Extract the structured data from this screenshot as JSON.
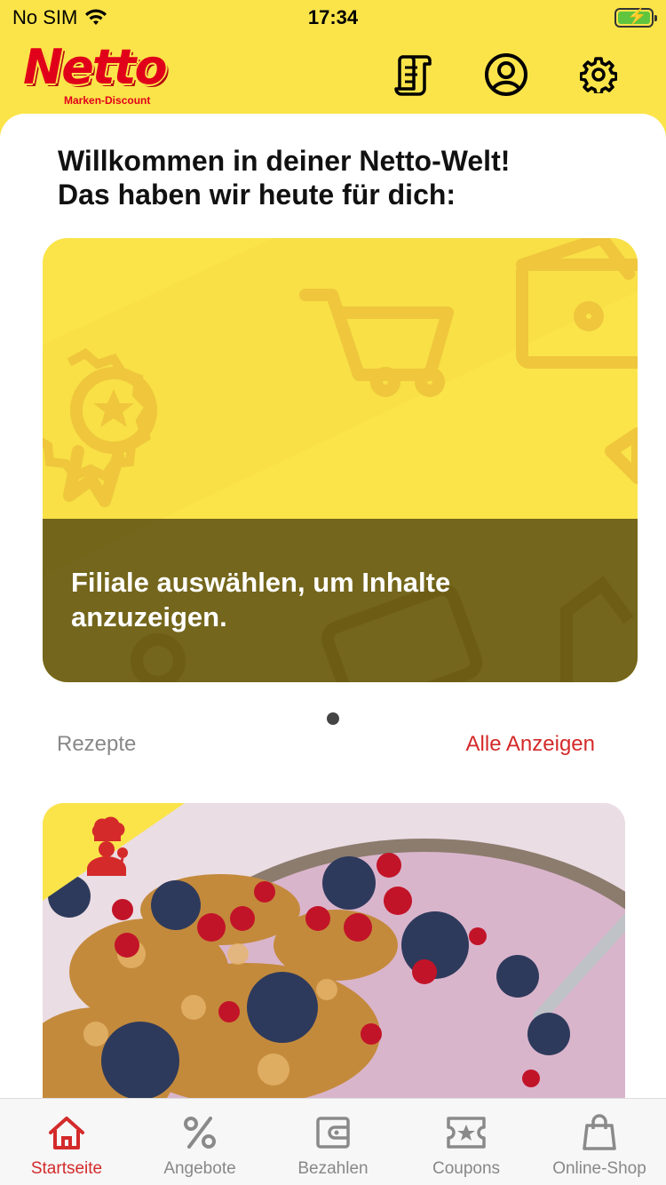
{
  "status": {
    "carrier": "No SIM",
    "time": "17:34"
  },
  "header": {
    "logo_word": "Netto",
    "logo_sub": "Marken-Discount",
    "icons": [
      "receipt-icon",
      "account-icon",
      "gear-icon"
    ]
  },
  "welcome": "Willkommen in deiner Netto-Welt!\nDas haben wir heute für dich:",
  "hero": {
    "text": "Filiale auswählen, um Inhalte anzuzeigen."
  },
  "recipes": {
    "label": "Rezepte",
    "all_label": "Alle Anzeigen"
  },
  "tabs": [
    {
      "label": "Startseite",
      "icon": "home-icon",
      "active": true
    },
    {
      "label": "Angebote",
      "icon": "percent-icon",
      "active": false
    },
    {
      "label": "Bezahlen",
      "icon": "wallet-icon",
      "active": false
    },
    {
      "label": "Coupons",
      "icon": "coupon-icon",
      "active": false
    },
    {
      "label": "Online-Shop",
      "icon": "shopping-bag-icon",
      "active": false
    }
  ],
  "colors": {
    "brand_yellow": "#FBE44A",
    "brand_red": "#E1001A",
    "accent_red": "#D42A2A"
  }
}
